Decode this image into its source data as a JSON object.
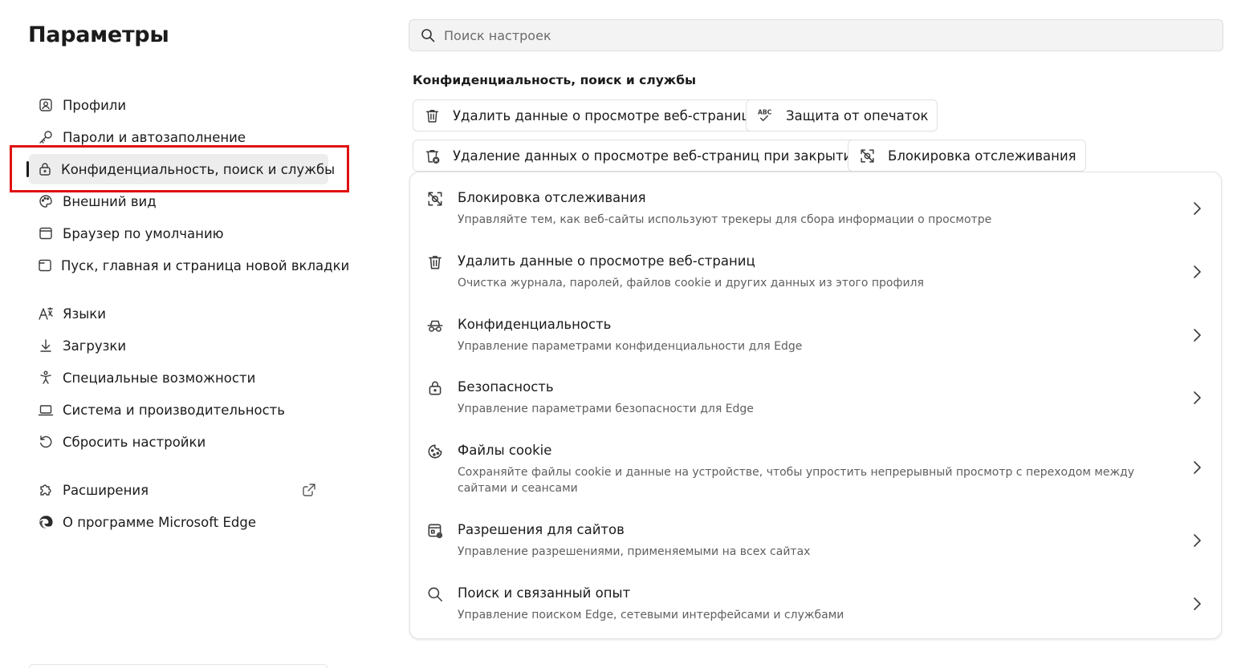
{
  "sidebar": {
    "title": "Параметры",
    "items": [
      {
        "label": "Профили",
        "icon": "profile-icon"
      },
      {
        "label": "Пароли и автозаполнение",
        "icon": "key-icon"
      },
      {
        "label": "Конфиденциальность, поиск и службы",
        "icon": "lock-icon",
        "active": true
      },
      {
        "label": "Внешний вид",
        "icon": "palette-icon"
      },
      {
        "label": "Браузер по умолчанию",
        "icon": "browser-window-icon"
      },
      {
        "label": "Пуск, главная и страница новой вкладки",
        "icon": "new-tab-icon"
      },
      {
        "label": "Языки",
        "icon": "languages-icon"
      },
      {
        "label": "Загрузки",
        "icon": "download-icon"
      },
      {
        "label": "Специальные возможности",
        "icon": "accessibility-icon"
      },
      {
        "label": "Система и производительность",
        "icon": "laptop-icon"
      },
      {
        "label": "Сбросить настройки",
        "icon": "reset-icon"
      },
      {
        "label": "Расширения",
        "icon": "puzzle-icon"
      },
      {
        "label": "О программе Microsoft Edge",
        "icon": "edge-logo-icon"
      }
    ]
  },
  "search": {
    "placeholder": "Поиск настроек"
  },
  "main": {
    "section_title": "Конфиденциальность, поиск и службы",
    "chips": [
      {
        "label": "Удалить данные о просмотре веб-страниц",
        "icon": "trash-icon"
      },
      {
        "label": "Защита от опечаток",
        "icon": "spellcheck-icon"
      },
      {
        "label": "Удаление данных о просмотре веб-страниц при закрытии",
        "icon": "trash-close-icon"
      },
      {
        "label": "Блокировка отслеживания",
        "icon": "tracking-block-icon"
      }
    ],
    "rows": [
      {
        "title": "Блокировка отслеживания",
        "desc": "Управляйте тем, как веб-сайты используют трекеры для сбора информации о просмотре",
        "icon": "tracking-block-icon"
      },
      {
        "title": "Удалить данные о просмотре веб-страниц",
        "desc": "Очистка журнала, паролей, файлов cookie и других данных из этого профиля",
        "icon": "trash-icon"
      },
      {
        "title": "Конфиденциальность",
        "desc": "Управление параметрами конфиденциальности для Edge",
        "icon": "incognito-icon"
      },
      {
        "title": "Безопасность",
        "desc": "Управление параметрами безопасности для Edge",
        "icon": "lock-icon"
      },
      {
        "title": "Файлы cookie",
        "desc": "Сохраняйте файлы cookie и данные на устройстве, чтобы упростить непрерывный просмотр с переходом между сайтами и сеансами",
        "icon": "cookie-icon"
      },
      {
        "title": "Разрешения для сайтов",
        "desc": "Управление разрешениями, применяемыми на всех сайтах",
        "icon": "site-permissions-icon"
      },
      {
        "title": "Поиск и связанный опыт",
        "desc": "Управление поиском Edge, сетевыми интерфейсами и службами",
        "icon": "search-icon"
      }
    ]
  }
}
